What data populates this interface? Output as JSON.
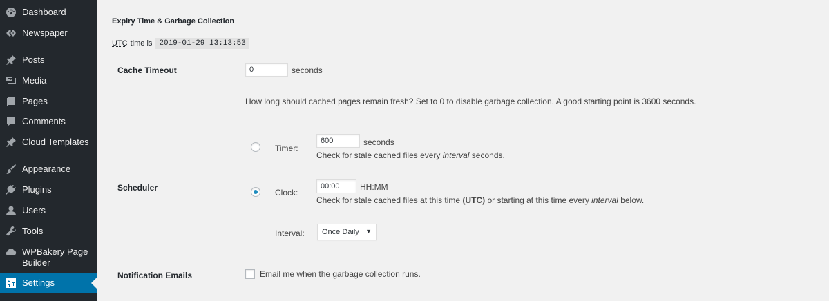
{
  "sidebar": {
    "items": [
      {
        "label": "Dashboard",
        "icon": "dashboard-icon"
      },
      {
        "label": "Newspaper",
        "icon": "newspaper-icon"
      },
      {
        "label": "Posts",
        "icon": "pin-icon"
      },
      {
        "label": "Media",
        "icon": "media-icon"
      },
      {
        "label": "Pages",
        "icon": "pages-icon"
      },
      {
        "label": "Comments",
        "icon": "comment-icon"
      },
      {
        "label": "Cloud Templates",
        "icon": "pin-icon"
      },
      {
        "label": "Appearance",
        "icon": "paintbrush-icon"
      },
      {
        "label": "Plugins",
        "icon": "plugin-icon"
      },
      {
        "label": "Users",
        "icon": "user-icon"
      },
      {
        "label": "Tools",
        "icon": "wrench-icon"
      },
      {
        "label": "WPBakery Page Builder",
        "icon": "cloud-icon"
      },
      {
        "label": "Settings",
        "icon": "settings-icon",
        "active": true
      }
    ]
  },
  "section": {
    "title": "Expiry Time & Garbage Collection",
    "utc_abbr": "UTC",
    "utc_text": "time is",
    "utc_value": "2019-01-29 13:13:53"
  },
  "cache_timeout": {
    "label": "Cache Timeout",
    "value": "0",
    "unit": "seconds",
    "description": "How long should cached pages remain fresh? Set to 0 to disable garbage collection. A good starting point is 3600 seconds."
  },
  "scheduler": {
    "label": "Scheduler",
    "timer": {
      "label": "Timer:",
      "value": "600",
      "unit": "seconds",
      "desc_before": "Check for stale cached files every",
      "desc_em": "interval",
      "desc_after": "seconds.",
      "checked": false
    },
    "clock": {
      "label": "Clock:",
      "value": "00:00",
      "unit": "HH:MM",
      "desc_before": "Check for stale cached files at this time",
      "desc_bold": "(UTC)",
      "desc_middle": "or starting at this time every",
      "desc_em": "interval",
      "desc_after": "below.",
      "checked": true
    },
    "interval": {
      "label": "Interval:",
      "selected": "Once Daily"
    }
  },
  "notification": {
    "label": "Notification Emails",
    "checkbox_label": "Email me when the garbage collection runs.",
    "checked": false
  },
  "colors": {
    "sidebar_bg": "#23282d",
    "active_bg": "#0073aa",
    "page_bg": "#f1f1f1",
    "radio_dot": "#1e8cbe"
  }
}
